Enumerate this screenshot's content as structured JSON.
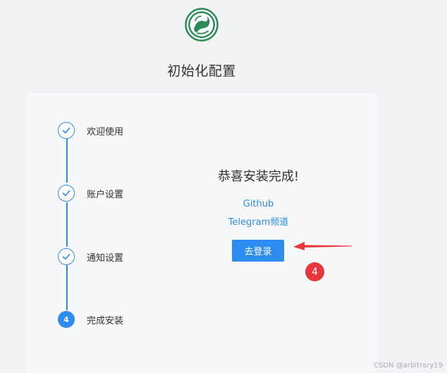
{
  "header": {
    "title": "初始化配置"
  },
  "steps": [
    {
      "label": "欢迎使用",
      "status": "done"
    },
    {
      "label": "账户设置",
      "status": "done"
    },
    {
      "label": "通知设置",
      "status": "done"
    },
    {
      "label": "完成安装",
      "status": "active",
      "number": "4"
    }
  ],
  "main": {
    "heading": "恭喜安装完成!",
    "links": [
      "Github",
      "Telegram频道"
    ],
    "login_button": "去登录"
  },
  "annotation": {
    "badge": "4"
  },
  "watermark": "CSDN @arbitrary19",
  "colors": {
    "accent": "#2d8cf0",
    "annotation": "#e8363b"
  }
}
